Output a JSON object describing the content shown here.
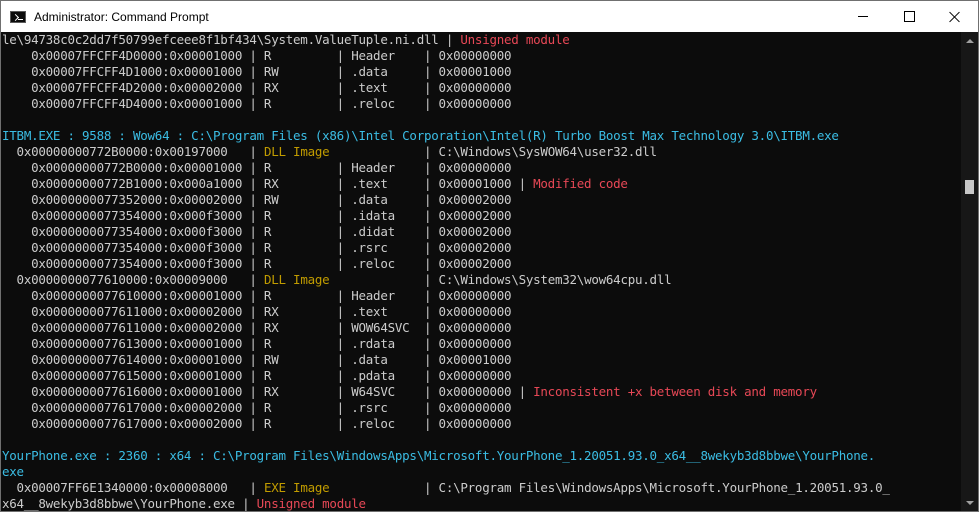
{
  "window": {
    "title": "Administrator: Command Prompt",
    "icon": "cmd-icon"
  },
  "controls": {
    "minimize_icon": "minimize-icon",
    "maximize_icon": "maximize-icon",
    "close_icon": "close-icon"
  },
  "colors": {
    "default": "#cccccc",
    "cyan": "#3bbde4",
    "yellow": "#c19c00",
    "red": "#e74856",
    "background": "#0c0c0c"
  },
  "lines": [
    [
      {
        "t": "le\\94738c0c2dd7f50799efceee8f1bf434\\System.ValueTuple.ni.dll | "
      },
      {
        "t": "Unsigned module",
        "c": "red"
      }
    ],
    [
      {
        "t": "    0x00007FFCFF4D0000:0x00001000 | R         | Header    | 0x00000000"
      }
    ],
    [
      {
        "t": "    0x00007FFCFF4D1000:0x00001000 | RW        | .data     | 0x00001000"
      }
    ],
    [
      {
        "t": "    0x00007FFCFF4D2000:0x00002000 | RX        | .text     | 0x00000000"
      }
    ],
    [
      {
        "t": "    0x00007FFCFF4D4000:0x00001000 | R         | .reloc    | 0x00000000"
      }
    ],
    [
      {
        "t": ""
      }
    ],
    [
      {
        "t": "ITBM.EXE : 9588 : Wow64 : C:\\Program Files (x86)\\Intel Corporation\\Intel(R) Turbo Boost Max Technology 3.0\\ITBM.exe",
        "c": "cyan"
      }
    ],
    [
      {
        "t": "  0x00000000772B0000:0x00197000   | "
      },
      {
        "t": "DLL Image",
        "c": "yellow"
      },
      {
        "t": "             | C:\\Windows\\SysWOW64\\user32.dll"
      }
    ],
    [
      {
        "t": "    0x00000000772B0000:0x00001000 | R         | Header    | 0x00000000"
      }
    ],
    [
      {
        "t": "    0x00000000772B1000:0x000a1000 | RX        | .text     | 0x00001000 | "
      },
      {
        "t": "Modified code",
        "c": "red"
      }
    ],
    [
      {
        "t": "    0x0000000077352000:0x00002000 | RW        | .data     | 0x00002000"
      }
    ],
    [
      {
        "t": "    0x0000000077354000:0x000f3000 | R         | .idata    | 0x00002000"
      }
    ],
    [
      {
        "t": "    0x0000000077354000:0x000f3000 | R         | .didat    | 0x00002000"
      }
    ],
    [
      {
        "t": "    0x0000000077354000:0x000f3000 | R         | .rsrc     | 0x00002000"
      }
    ],
    [
      {
        "t": "    0x0000000077354000:0x000f3000 | R         | .reloc    | 0x00002000"
      }
    ],
    [
      {
        "t": "  0x0000000077610000:0x00009000   | "
      },
      {
        "t": "DLL Image",
        "c": "yellow"
      },
      {
        "t": "             | C:\\Windows\\System32\\wow64cpu.dll"
      }
    ],
    [
      {
        "t": "    0x0000000077610000:0x00001000 | R         | Header    | 0x00000000"
      }
    ],
    [
      {
        "t": "    0x0000000077611000:0x00002000 | RX        | .text     | 0x00000000"
      }
    ],
    [
      {
        "t": "    0x0000000077611000:0x00002000 | RX        | WOW64SVC  | 0x00000000"
      }
    ],
    [
      {
        "t": "    0x0000000077613000:0x00001000 | R         | .rdata    | 0x00000000"
      }
    ],
    [
      {
        "t": "    0x0000000077614000:0x00001000 | RW        | .data     | 0x00001000"
      }
    ],
    [
      {
        "t": "    0x0000000077615000:0x00001000 | R         | .pdata    | 0x00000000"
      }
    ],
    [
      {
        "t": "    0x0000000077616000:0x00001000 | RX        | W64SVC    | 0x00000000 | "
      },
      {
        "t": "Inconsistent +x between disk and memory",
        "c": "red"
      }
    ],
    [
      {
        "t": "    0x0000000077617000:0x00002000 | R         | .rsrc     | 0x00000000"
      }
    ],
    [
      {
        "t": "    0x0000000077617000:0x00002000 | R         | .reloc    | 0x00000000"
      }
    ],
    [
      {
        "t": ""
      }
    ],
    [
      {
        "t": "YourPhone.exe : 2360 : x64 : C:\\Program Files\\WindowsApps\\Microsoft.YourPhone_1.20051.93.0_x64__8wekyb3d8bbwe\\YourPhone.",
        "c": "cyan"
      }
    ],
    [
      {
        "t": "exe",
        "c": "cyan"
      }
    ],
    [
      {
        "t": "  0x00007FF6E1340000:0x00008000   | "
      },
      {
        "t": "EXE Image",
        "c": "yellow"
      },
      {
        "t": "             | C:\\Program Files\\WindowsApps\\Microsoft.YourPhone_1.20051.93.0_"
      }
    ],
    [
      {
        "t": "x64__8wekyb3d8bbwe\\YourPhone.exe | "
      },
      {
        "t": "Unsigned module",
        "c": "red"
      }
    ]
  ]
}
